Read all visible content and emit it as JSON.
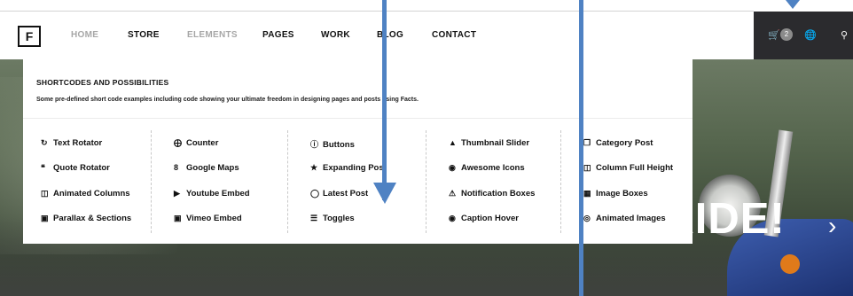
{
  "brand": {
    "logo_letter": "F"
  },
  "nav": {
    "items": [
      {
        "label": "HOME",
        "dim": true
      },
      {
        "label": "STORE",
        "dim": false
      },
      {
        "label": "ELEMENTS",
        "dim": true
      },
      {
        "label": "PAGES",
        "dim": false
      },
      {
        "label": "WORK",
        "dim": false
      },
      {
        "label": "BLOG",
        "dim": false
      },
      {
        "label": "CONTACT",
        "dim": false
      }
    ],
    "cart_count": "2"
  },
  "mega": {
    "title": "SHORTCODES AND POSSIBILITIES",
    "subtitle": "Some pre-defined short code examples including code showing your ultimate freedom in designing pages and posts using Facts.",
    "columns": [
      [
        {
          "label": "Text Rotator",
          "icon": "rotate-icon"
        },
        {
          "label": "Quote Rotator",
          "icon": "quote-icon"
        },
        {
          "label": "Animated Columns",
          "icon": "columns-icon"
        },
        {
          "label": "Parallax & Sections",
          "icon": "image-icon"
        }
      ],
      [
        {
          "label": "Counter",
          "icon": "counter-icon"
        },
        {
          "label": "Google Maps",
          "icon": "google-icon"
        },
        {
          "label": "Youtube Embed",
          "icon": "youtube-icon"
        },
        {
          "label": "Vimeo Embed",
          "icon": "vimeo-icon"
        }
      ],
      [
        {
          "label": "Buttons",
          "icon": "info-icon"
        },
        {
          "label": "Expanding Post",
          "icon": "star-icon"
        },
        {
          "label": "Latest Post",
          "icon": "comment-icon"
        },
        {
          "label": "Toggles",
          "icon": "list-icon"
        }
      ],
      [
        {
          "label": "Thumbnail Slider",
          "icon": "thumbs-up-icon"
        },
        {
          "label": "Awesome Icons",
          "icon": "eye-icon"
        },
        {
          "label": "Notification Boxes",
          "icon": "warning-icon"
        },
        {
          "label": "Caption Hover",
          "icon": "camera-icon"
        }
      ],
      [
        {
          "label": "Category Post",
          "icon": "copy-icon"
        },
        {
          "label": "Column Full Height",
          "icon": "columns-icon"
        },
        {
          "label": "Image Boxes",
          "icon": "grid-icon"
        },
        {
          "label": "Animated Images",
          "icon": "eye-slash-icon"
        }
      ]
    ]
  },
  "hero": {
    "title": "LIFE IS GOOD. ENJOY THE RIDE!"
  },
  "colors": {
    "accent_blue": "#4f82c3",
    "nav_dark": "#2b2b2e"
  }
}
